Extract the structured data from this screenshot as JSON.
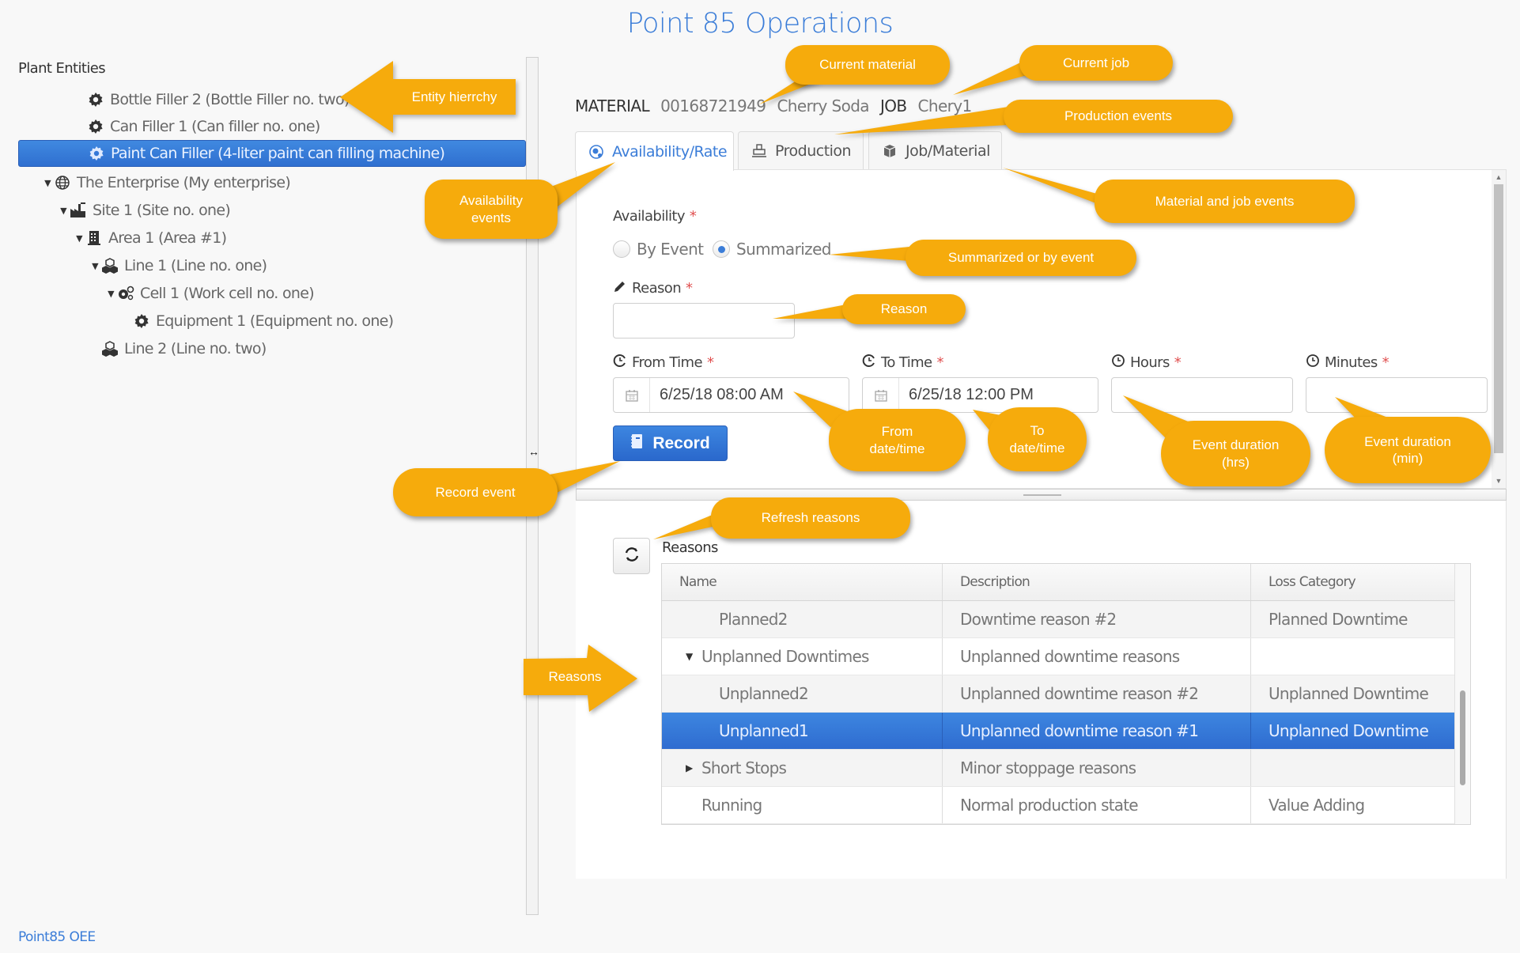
{
  "title": "Point 85 Operations",
  "tree": {
    "header": "Plant Entities",
    "items": [
      {
        "label": "Bottle Filler 2 (Bottle Filler no. two)",
        "icon": "gear-icon",
        "level": 0,
        "expanded": null,
        "selected": false
      },
      {
        "label": "Can Filler 1 (Can filler no. one)",
        "icon": "gear-icon",
        "level": 0,
        "expanded": null,
        "selected": false
      },
      {
        "label": "Paint Can Filler (4-liter paint can filling machine)",
        "icon": "gear-icon",
        "level": 0,
        "expanded": null,
        "selected": true
      },
      {
        "label": "The Enterprise (My enterprise)",
        "icon": "globe-icon",
        "level": 0,
        "expanded": true,
        "selected": false
      },
      {
        "label": "Site 1 (Site no. one)",
        "icon": "factory-icon",
        "level": 1,
        "expanded": true,
        "selected": false
      },
      {
        "label": "Area 1 (Area #1)",
        "icon": "building-icon",
        "level": 2,
        "expanded": true,
        "selected": false
      },
      {
        "label": "Line 1 (Line no. one)",
        "icon": "cubes-icon",
        "level": 3,
        "expanded": true,
        "selected": false
      },
      {
        "label": "Cell 1 (Work cell no. one)",
        "icon": "gears-icon",
        "level": 4,
        "expanded": true,
        "selected": false
      },
      {
        "label": "Equipment 1 (Equipment no. one)",
        "icon": "gear-icon",
        "level": 5,
        "expanded": null,
        "selected": false
      },
      {
        "label": "Line 2 (Line no. two)",
        "icon": "cubes-icon",
        "level": 3,
        "expanded": null,
        "selected": false
      }
    ]
  },
  "material_bar": {
    "material_label": "MATERIAL",
    "material_id": "00168721949",
    "material_name": "Cherry Soda",
    "job_label": "JOB",
    "job_value": "Chery1"
  },
  "tabs": [
    {
      "label": "Availability/Rate",
      "icon": "availability-icon",
      "active": true
    },
    {
      "label": "Production",
      "icon": "production-icon",
      "active": false
    },
    {
      "label": "Job/Material",
      "icon": "box-icon",
      "active": false
    }
  ],
  "form": {
    "availability_label": "Availability",
    "required_mark": "*",
    "radio_by_event": "By Event",
    "radio_summarized": "Summarized",
    "selected_mode": "Summarized",
    "reason_label": "Reason",
    "reason_value": "",
    "from_label": "From Time",
    "from_value": "6/25/18 08:00 AM",
    "to_label": "To Time",
    "to_value": "6/25/18 12:00 PM",
    "hours_label": "Hours",
    "hours_value": "",
    "minutes_label": "Minutes",
    "minutes_value": "",
    "record_label": "Record"
  },
  "reasons": {
    "label": "Reasons",
    "columns": [
      "Name",
      "Description",
      "Loss Category"
    ],
    "rows": [
      {
        "name": "Planned2",
        "description": "Downtime reason #2",
        "loss_category": "Planned Downtime",
        "indent": 1,
        "toggle": "",
        "selected": false
      },
      {
        "name": "Unplanned Downtimes",
        "description": "Unplanned downtime reasons",
        "loss_category": "",
        "indent": 0,
        "toggle": "expanded",
        "selected": false
      },
      {
        "name": "Unplanned2",
        "description": "Unplanned downtime reason #2",
        "loss_category": "Unplanned Downtime",
        "indent": 1,
        "toggle": "",
        "selected": false
      },
      {
        "name": "Unplanned1",
        "description": "Unplanned downtime reason #1",
        "loss_category": "Unplanned Downtime",
        "indent": 1,
        "toggle": "",
        "selected": true
      },
      {
        "name": "Short Stops",
        "description": "Minor stoppage reasons",
        "loss_category": "",
        "indent": 0,
        "toggle": "collapsed",
        "selected": false
      },
      {
        "name": "Running",
        "description": "Normal production state",
        "loss_category": "Value Adding",
        "indent": 0,
        "toggle": "",
        "selected": false
      }
    ]
  },
  "footer": "Point85 OEE",
  "callouts": {
    "entity_hierarchy": "Entity hierrchy",
    "current_material": "Current material",
    "current_job": "Current job",
    "production_events": "Production events",
    "availability_events": "Availability\nevents",
    "material_job_events": "Material and job events",
    "summarized_or_by_event": "Summarized or by event",
    "reason": "Reason",
    "from_datetime": "From\ndate/time",
    "to_datetime": "To\ndate/time",
    "duration_hrs": "Event duration\n(hrs)",
    "duration_min": "Event duration\n(min)",
    "record_event": "Record event",
    "refresh_reasons": "Refresh reasons",
    "reasons": "Reasons"
  },
  "colors": {
    "accent": "#3b7dd8",
    "selection": "#2f6fd0",
    "callout": "#f6ab0c",
    "required": "#e05050"
  }
}
